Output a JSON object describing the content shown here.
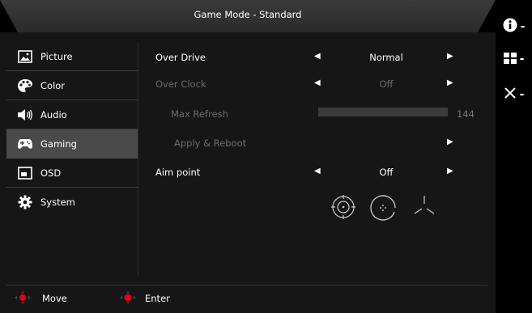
{
  "window": {
    "title": "Game Mode - Standard"
  },
  "sidebar": {
    "items": [
      {
        "label": "Picture",
        "icon": "picture-icon"
      },
      {
        "label": "Color",
        "icon": "palette-icon"
      },
      {
        "label": "Audio",
        "icon": "speaker-icon"
      },
      {
        "label": "Gaming",
        "icon": "gamepad-icon",
        "active": true
      },
      {
        "label": "OSD",
        "icon": "osd-icon"
      },
      {
        "label": "System",
        "icon": "gear-icon"
      }
    ]
  },
  "settings": {
    "over_drive": {
      "label": "Over Drive",
      "value": "Normal"
    },
    "over_clock": {
      "label": "Over Clock",
      "value": "Off"
    },
    "max_refresh": {
      "label": "Max Refresh",
      "value": "144"
    },
    "apply_reboot": {
      "label": "Apply & Reboot"
    },
    "aim_point": {
      "label": "Aim point",
      "value": "Off"
    }
  },
  "footer": {
    "move_label": "Move",
    "enter_label": "Enter"
  },
  "right_bar": {
    "items": [
      {
        "icon": "info-icon",
        "dash": "-"
      },
      {
        "icon": "grid-icon",
        "dash": "-"
      },
      {
        "icon": "close-icon",
        "dash": "-"
      }
    ]
  },
  "colors": {
    "accent": "#e0001b",
    "active_bg": "#4a4a4a",
    "panel_bg": "#161616"
  }
}
